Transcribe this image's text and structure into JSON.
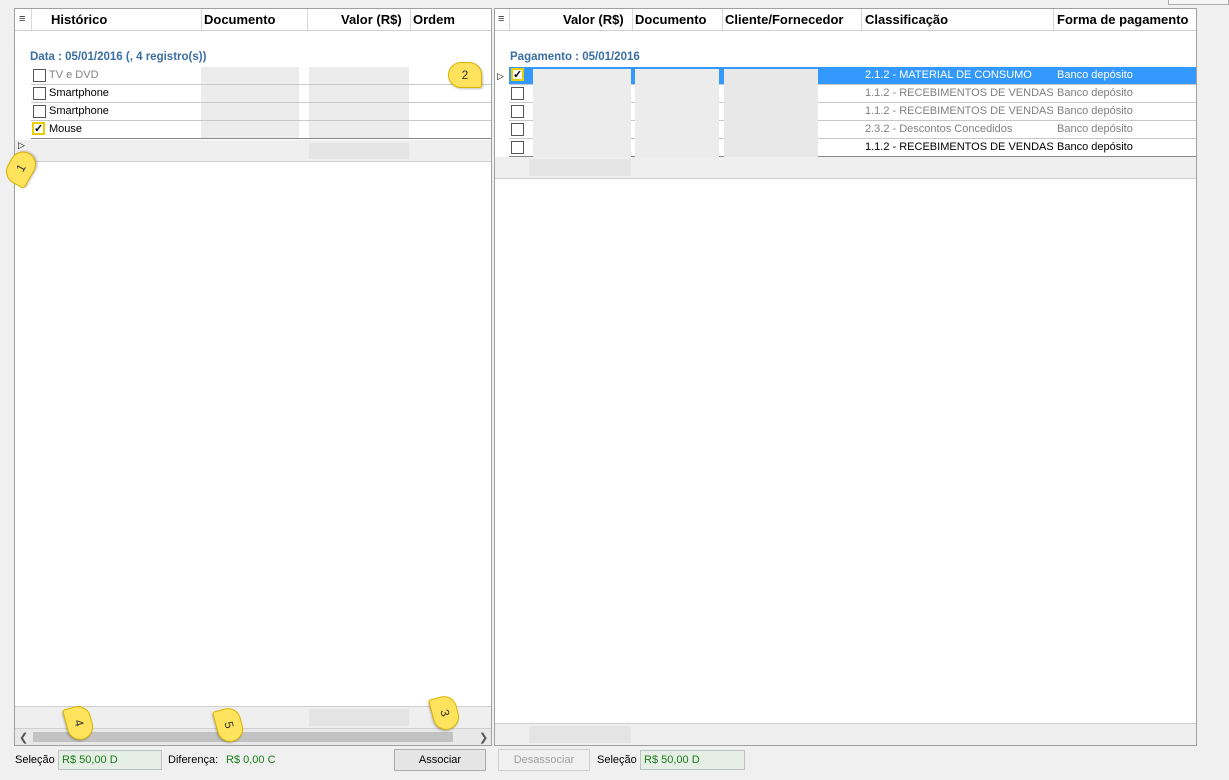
{
  "left_grid": {
    "columns": [
      "Histórico",
      "Documento",
      "Valor (R$)",
      "Ordem"
    ],
    "group_label": "Data : 05/01/2016 (, 4 registro(s))",
    "rows": [
      {
        "historico": "TV e DVD",
        "checked": false,
        "muted": true
      },
      {
        "historico": "Smartphone",
        "checked": false,
        "muted": false
      },
      {
        "historico": "Smartphone",
        "checked": false,
        "muted": false
      },
      {
        "historico": "Mouse",
        "checked": true,
        "muted": false
      }
    ]
  },
  "right_grid": {
    "columns": [
      "Valor (R$)",
      "Documento",
      "Cliente/Fornecedor",
      "Classificação",
      "Forma de pagamento"
    ],
    "group_label": "Pagamento : 05/01/2016",
    "rows": [
      {
        "classificacao": "2.1.2 - MATERIAL DE CONSUMO",
        "forma": "Banco depósito",
        "checked": true,
        "selected": true
      },
      {
        "classificacao": "1.1.2 - RECEBIMENTOS DE VENDAS",
        "forma": "Banco depósito",
        "checked": false,
        "muted": true
      },
      {
        "classificacao": "1.1.2 - RECEBIMENTOS DE VENDAS",
        "forma": "Banco depósito",
        "checked": false,
        "muted": true
      },
      {
        "classificacao": "2.3.2 - Descontos Concedidos",
        "forma": "Banco depósito",
        "checked": false,
        "muted": true
      },
      {
        "classificacao": "1.1.2 - RECEBIMENTOS DE VENDAS",
        "forma": "Banco depósito",
        "checked": false,
        "muted": false
      }
    ]
  },
  "footer": {
    "selecao_label": "Seleção",
    "selecao_left": "R$ 50,00 D",
    "diferenca_label": "Diferença:",
    "diferenca_value": "R$ 0,00 C",
    "associar": "Associar",
    "desassociar": "Desassociar",
    "selecao_right_label": "Seleção",
    "selecao_right": "R$ 50,00 D"
  },
  "callouts": [
    "1",
    "2",
    "3",
    "4",
    "5"
  ]
}
